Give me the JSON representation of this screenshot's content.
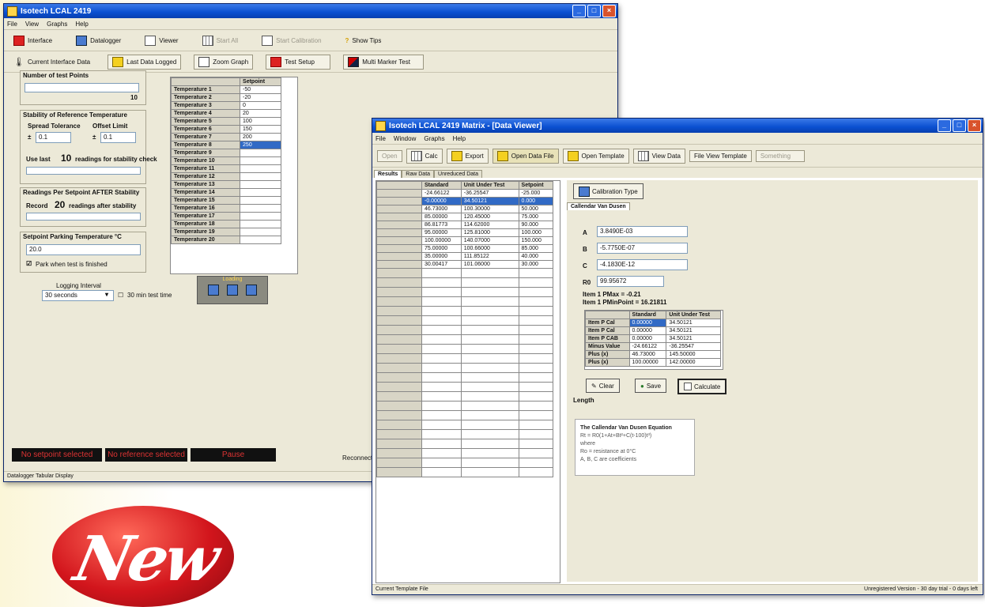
{
  "back_window": {
    "title": "Isotech LCAL 2419",
    "menu": [
      "File",
      "View",
      "Graphs",
      "Help"
    ],
    "toolbar1": [
      {
        "label": "Interface",
        "icon": "interface-icon"
      },
      {
        "label": "Datalogger",
        "icon": "datalogger-icon"
      },
      {
        "label": "Viewer",
        "icon": "viewer-icon"
      },
      {
        "label": "Start All",
        "icon": "start-icon"
      },
      {
        "label": "Start Calibration",
        "icon": "calibration-icon"
      },
      {
        "label": "Show Tips",
        "icon": "tips-icon"
      }
    ],
    "toolbar2": [
      {
        "label": "Current Interface Data",
        "icon": "thermometer-icon"
      },
      {
        "label": "Last Data Logged",
        "icon": "log-icon"
      },
      {
        "label": "Zoom Graph",
        "icon": "graph-icon"
      },
      {
        "label": "Test Setup",
        "icon": "setup-icon"
      },
      {
        "label": "Multi Marker Test",
        "icon": "marker-icon"
      }
    ],
    "number_of_test_points_label": "Number of test Points",
    "number_of_test_points_value": "10",
    "stability_label": "Stability of Reference Temperature",
    "spread_tolerance_label": "Spread Tolerance",
    "spread_tolerance_value": "0.1",
    "offset_limit_label": "Offset Limit",
    "offset_limit_value": "0.1",
    "use_last_label": "Use last",
    "use_last_value": "10",
    "use_last_suffix": "readings for stability check",
    "readings_label": "Readings Per Setpoint AFTER Stability",
    "record_label": "Record",
    "record_value": "20",
    "record_suffix": "readings after stability",
    "parking_label": "Setpoint Parking Temperature °C",
    "parking_value": "20.0",
    "park_checkbox_label": "Park when test is finished",
    "logging_interval_label": "Logging Interval",
    "logging_interval_value": "30 seconds",
    "test_time_label": "30 min test time",
    "setpoint_header": "Setpoint",
    "setpoints": [
      {
        "name": "Temperature 1",
        "value": "-50"
      },
      {
        "name": "Temperature 2",
        "value": "-20"
      },
      {
        "name": "Temperature 3",
        "value": "0"
      },
      {
        "name": "Temperature 4",
        "value": "20"
      },
      {
        "name": "Temperature 5",
        "value": "100"
      },
      {
        "name": "Temperature 6",
        "value": "150"
      },
      {
        "name": "Temperature 7",
        "value": "200"
      },
      {
        "name": "Temperature 8",
        "value": "250"
      },
      {
        "name": "Temperature 9",
        "value": ""
      },
      {
        "name": "Temperature 10",
        "value": ""
      },
      {
        "name": "Temperature 11",
        "value": ""
      },
      {
        "name": "Temperature 12",
        "value": ""
      },
      {
        "name": "Temperature 13",
        "value": ""
      },
      {
        "name": "Temperature 14",
        "value": ""
      },
      {
        "name": "Temperature 15",
        "value": ""
      },
      {
        "name": "Temperature 16",
        "value": ""
      },
      {
        "name": "Temperature 17",
        "value": ""
      },
      {
        "name": "Temperature 18",
        "value": ""
      },
      {
        "name": "Temperature 19",
        "value": ""
      },
      {
        "name": "Temperature 20",
        "value": ""
      }
    ],
    "loading_label": "Loading",
    "status_setpoint": "No setpoint selected",
    "status_reference": "No reference selected",
    "status_pause": "Pause",
    "status_right": "Reconnect",
    "statusbar": "Datalogger Tabular Display"
  },
  "front_window": {
    "title": "Isotech LCAL 2419 Matrix - [Data Viewer]",
    "menu": [
      "File",
      "Window",
      "Graphs",
      "Help"
    ],
    "toolbar": [
      {
        "label": "Open",
        "icon": "open-icon",
        "enabled": false
      },
      {
        "label": "Calc",
        "icon": "calc-icon",
        "enabled": true
      },
      {
        "label": "Export",
        "icon": "export-icon",
        "enabled": true
      },
      {
        "label": "Open Data File",
        "icon": "open-file-icon",
        "enabled": true
      },
      {
        "label": "Open Template",
        "icon": "template-icon",
        "enabled": true
      },
      {
        "label": "View Data",
        "icon": "view-icon",
        "enabled": true
      },
      {
        "label": "File View Template",
        "icon": "file-template-icon",
        "enabled": true
      },
      {
        "label": "Something",
        "icon": "other-icon",
        "enabled": false
      }
    ],
    "tabs": [
      "Results",
      "Raw Data",
      "Unreduced Data"
    ],
    "table_headers": [
      "Standard",
      "Unit Under Test",
      "Setpoint"
    ],
    "table_rows": [
      [
        "-24.66122",
        "-36.25547",
        "-25.000"
      ],
      [
        "-0.00000",
        "34.50121",
        "0.000"
      ],
      [
        "46.73000",
        "100.30000",
        "50.000"
      ],
      [
        "85.00000",
        "120.45000",
        "75.000"
      ],
      [
        "86.81773",
        "114.62000",
        "90.000"
      ],
      [
        "95.00000",
        "125.81000",
        "100.000"
      ],
      [
        "100.00000",
        "140.07000",
        "150.000"
      ],
      [
        "75.00000",
        "100.66000",
        "85.000"
      ],
      [
        "35.00000",
        "111.85122",
        "40.000"
      ],
      [
        "30.00417",
        "101.06000",
        "30.000"
      ]
    ],
    "calibration_button": "Calibration Type",
    "calibration_tab": "Callendar Van Dusen",
    "coef_a_label": "A",
    "coef_a_value": "3.8490E-03",
    "coef_b_label": "B",
    "coef_b_value": "-5.7750E-07",
    "coef_c_label": "C",
    "coef_c_value": "-4.1830E-12",
    "r0_label": "R0",
    "r0_value": "99.95672",
    "note1": "Item 1 PMax = -0.21",
    "note2": "Item 1 PMinPoint = 16.21811",
    "summary_headers": [
      "",
      "Standard",
      "Unit Under Test"
    ],
    "summary_rows": [
      [
        "Item P Cal",
        "0.00000",
        "34.50121"
      ],
      [
        "Item P Cal",
        "0.00000",
        "34.50121"
      ],
      [
        "Item P CAB",
        "0.00000",
        "34.50121"
      ],
      [
        "Minus Value",
        "-24.66122",
        "-36.25547"
      ],
      [
        "Plus (x)",
        "46.73000",
        "145.50000"
      ],
      [
        "Plus (x)",
        "100.00000",
        "142.00000"
      ]
    ],
    "clear_button": "Clear",
    "save_button": "Save",
    "calculate_button": "Calculate",
    "length_label": "Length",
    "equation_title": "The Callendar Van Dusen Equation",
    "equation_line": "Rt = R0(1+At+Bt²+C(t-100)t³)",
    "equation_where": "where",
    "equation_r0": "Ro = resistance at 0°C",
    "equation_coeffs": "A, B, C are coefficients",
    "statusbar_left": "Current Template File",
    "statusbar_right": "Unregistered Version - 30 day trial - 0 days left"
  },
  "logo_text": "New"
}
